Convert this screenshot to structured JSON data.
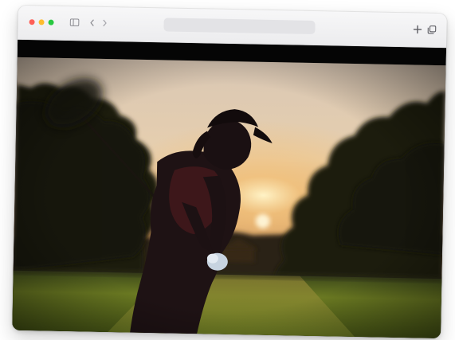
{
  "browser": {
    "address": "",
    "icons": [
      "close-dot",
      "minimize-dot",
      "zoom-dot",
      "sidebar-icon",
      "chevron-left-icon",
      "chevron-right-icon",
      "plus-icon",
      "tabs-overview-icon"
    ]
  },
  "content": {
    "description_icon": "golfer-silhouette-sunset-video"
  },
  "colors": {
    "red": "#fe5f57",
    "yellow": "#febc2e",
    "green": "#28c840",
    "sky": "#e8d2b6",
    "grass": "#5a6a1c"
  }
}
